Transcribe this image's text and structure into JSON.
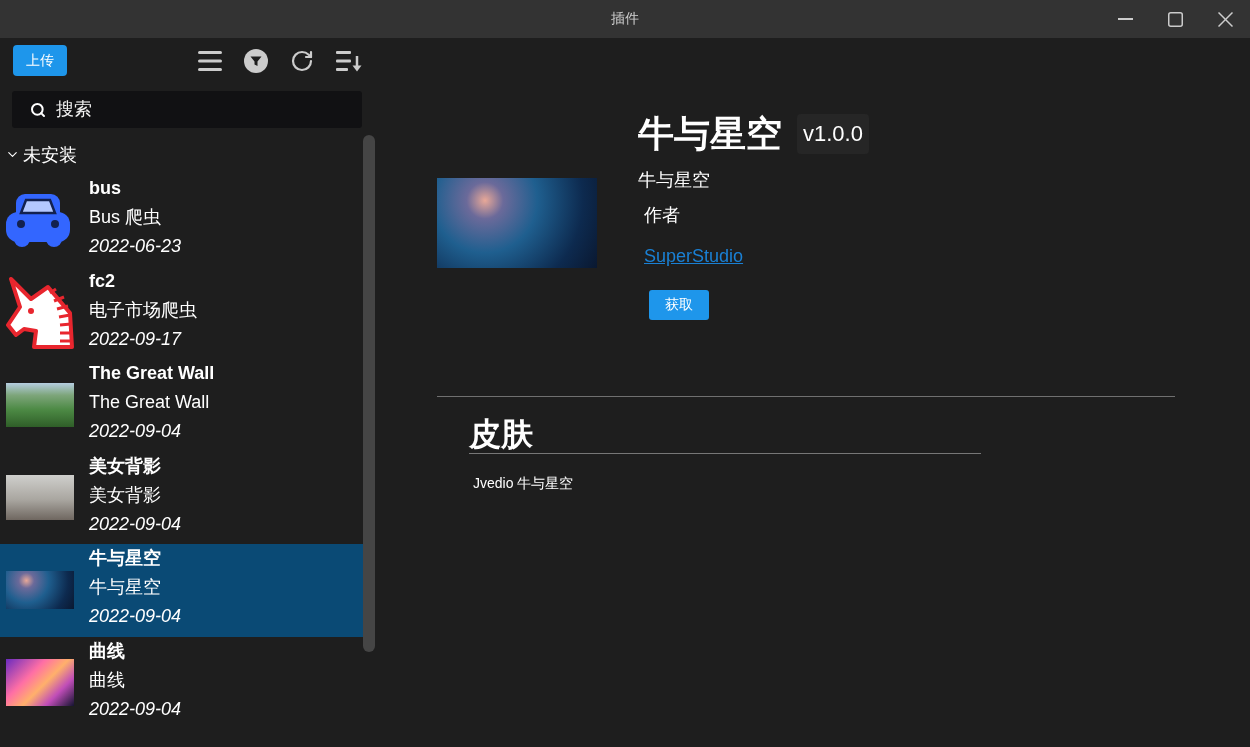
{
  "window": {
    "title": "插件"
  },
  "sidebar": {
    "upload_button": "上传",
    "search": {
      "placeholder": "搜索"
    },
    "groups": [
      {
        "label": "未安装",
        "expanded": true,
        "items": [
          {
            "kind": "car",
            "name": "bus",
            "description": "Bus 爬虫",
            "date": "2022-06-23",
            "selected": false
          },
          {
            "kind": "unicorn",
            "name": "fc2",
            "description": "电子市场爬虫",
            "date": "2022-09-17",
            "selected": false
          },
          {
            "kind": "mountains",
            "name": "The Great Wall",
            "description": "The Great Wall",
            "date": "2022-09-04",
            "selected": false
          },
          {
            "kind": "lake",
            "name": "美女背影",
            "description": "美女背影",
            "date": "2022-09-04",
            "selected": false
          },
          {
            "kind": "nightsky",
            "name": "牛与星空",
            "description": "牛与星空",
            "date": "2022-09-04",
            "selected": true
          },
          {
            "kind": "swirl",
            "name": "曲线",
            "description": "曲线",
            "date": "2022-09-04",
            "selected": false
          }
        ]
      }
    ]
  },
  "detail": {
    "title": "牛与星空",
    "version": "v1.0.0",
    "subtitle": "牛与星空",
    "author_label": "作者",
    "author": "SuperStudio",
    "action_button": "获取"
  },
  "section": {
    "heading": "皮肤",
    "text": "Jvedio 牛与星空"
  }
}
